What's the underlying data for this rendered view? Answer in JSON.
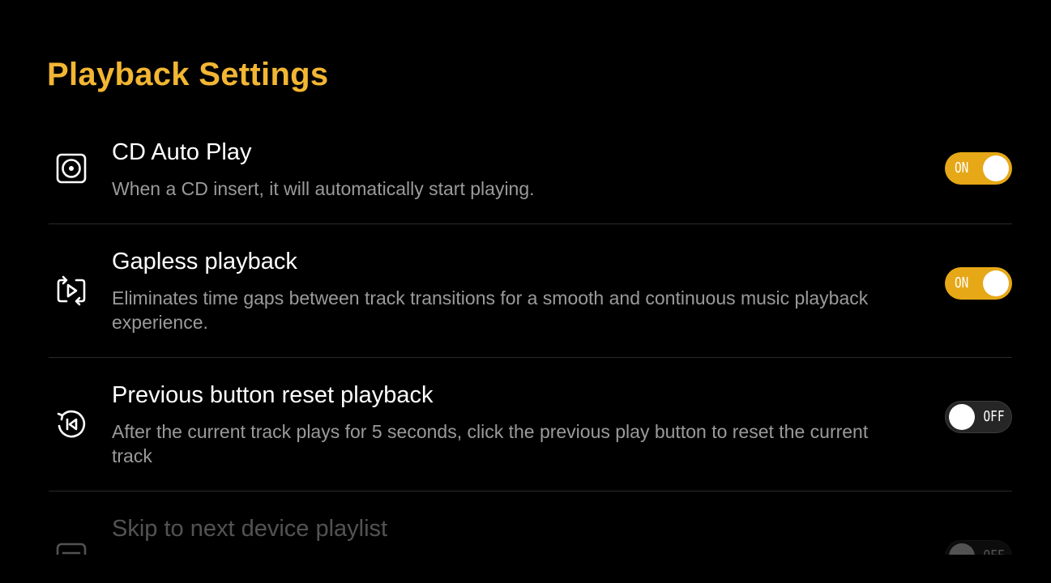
{
  "page": {
    "title": "Playback Settings"
  },
  "colors": {
    "accent": "#f2b632",
    "toggle_on": "#e6a817",
    "toggle_off": "#262626",
    "description": "#9a9a9a",
    "divider": "#2a2a2a"
  },
  "settings": [
    {
      "icon": "cd-disc-icon",
      "title": "CD Auto Play",
      "description": "When a CD insert, it will automatically start playing.",
      "state": "on",
      "toggle_label": "ON"
    },
    {
      "icon": "gapless-playback-icon",
      "title": "Gapless playback",
      "description": "Eliminates time gaps between track transitions for a smooth and continuous music playback experience.",
      "state": "on",
      "toggle_label": "ON"
    },
    {
      "icon": "previous-reset-icon",
      "title": "Previous button reset playback",
      "description": "After the current track plays for 5 seconds, click the previous play button to reset the current track",
      "state": "off",
      "toggle_label": "OFF"
    },
    {
      "icon": "playlist-icon",
      "title": "Skip to next device playlist",
      "description": "",
      "state": "off",
      "toggle_label": "OFF"
    }
  ]
}
